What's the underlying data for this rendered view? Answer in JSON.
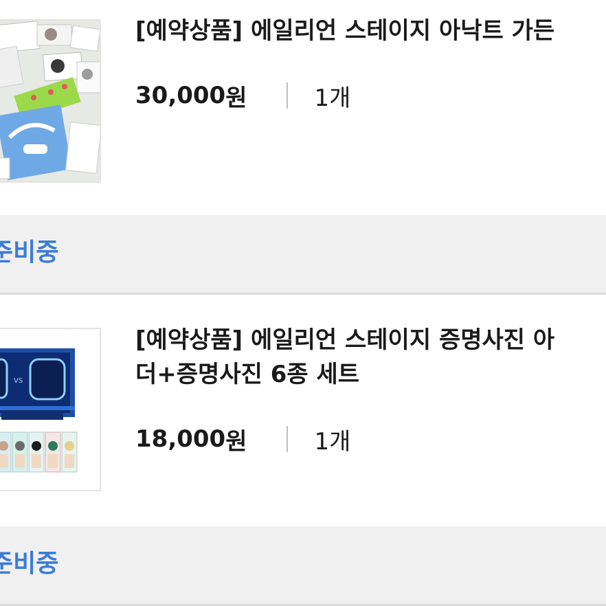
{
  "orders": [
    {
      "title": "[예약상품] 에일리언 스테이지 아낙트 가든",
      "price_num": "30,000",
      "price_unit": "원",
      "quantity": "1개",
      "status": "준비중",
      "thumbnail_icon": "product-photo-diary-set"
    },
    {
      "title": "[예약상품] 에일리언 스테이지 증명사진 아\n더+증명사진 6종 세트",
      "price_num": "18,000",
      "price_unit": "원",
      "quantity": "1개",
      "status": "준비중",
      "thumbnail_icon": "product-photo-id-photo-holder"
    }
  ],
  "colors": {
    "status_text": "#3d7bd6",
    "status_bg": "#f0f0f0"
  }
}
